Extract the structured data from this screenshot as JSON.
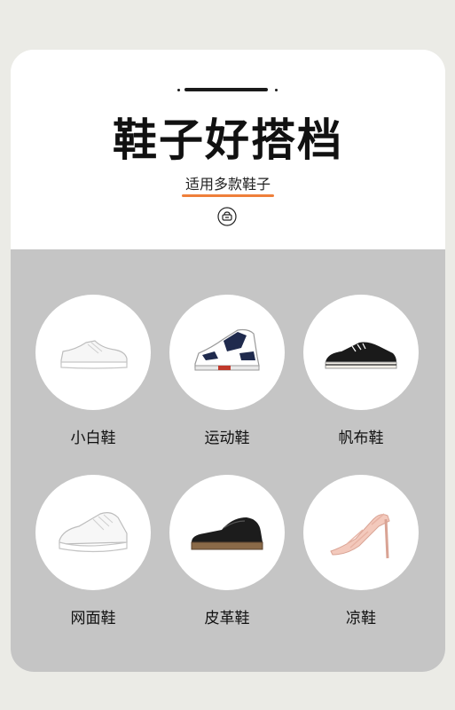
{
  "header": {
    "title": "鞋子好搭档",
    "subtitle": "适用多款鞋子",
    "icon": "hanger-icon"
  },
  "accent_color": "#ef7f3a",
  "grid_background": "#c5c5c5",
  "shoes": [
    {
      "label": "小白鞋",
      "icon": "white-sneaker-icon"
    },
    {
      "label": "运动鞋",
      "icon": "basketball-shoe-icon"
    },
    {
      "label": "帆布鞋",
      "icon": "canvas-shoe-icon"
    },
    {
      "label": "网面鞋",
      "icon": "mesh-running-shoe-icon"
    },
    {
      "label": "皮革鞋",
      "icon": "leather-shoe-icon"
    },
    {
      "label": "凉鞋",
      "icon": "high-heel-sandal-icon"
    }
  ]
}
